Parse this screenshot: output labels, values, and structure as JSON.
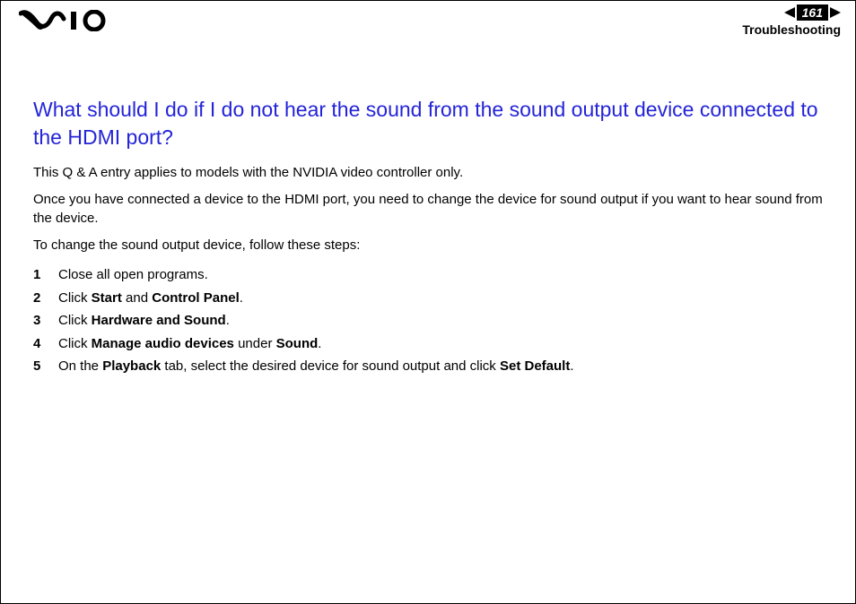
{
  "header": {
    "page_number": "161",
    "section": "Troubleshooting"
  },
  "title": "What should I do if I do not hear the sound from the sound output device connected to the HDMI port?",
  "para1": "This Q & A entry applies to models with the NVIDIA video controller only.",
  "para2": "Once you have connected a device to the HDMI port, you need to change the device for sound output if you want to hear sound from the device.",
  "para3": "To change the sound output device, follow these steps:",
  "steps": [
    {
      "n": "1",
      "segments": [
        {
          "t": "Close all open programs.",
          "b": false
        }
      ]
    },
    {
      "n": "2",
      "segments": [
        {
          "t": "Click ",
          "b": false
        },
        {
          "t": "Start",
          "b": true
        },
        {
          "t": " and ",
          "b": false
        },
        {
          "t": "Control Panel",
          "b": true
        },
        {
          "t": ".",
          "b": false
        }
      ]
    },
    {
      "n": "3",
      "segments": [
        {
          "t": "Click ",
          "b": false
        },
        {
          "t": "Hardware and Sound",
          "b": true
        },
        {
          "t": ".",
          "b": false
        }
      ]
    },
    {
      "n": "4",
      "segments": [
        {
          "t": "Click ",
          "b": false
        },
        {
          "t": "Manage audio devices",
          "b": true
        },
        {
          "t": " under ",
          "b": false
        },
        {
          "t": "Sound",
          "b": true
        },
        {
          "t": ".",
          "b": false
        }
      ]
    },
    {
      "n": "5",
      "segments": [
        {
          "t": "On the ",
          "b": false
        },
        {
          "t": "Playback",
          "b": true
        },
        {
          "t": " tab, select the desired device for sound output and click ",
          "b": false
        },
        {
          "t": "Set Default",
          "b": true
        },
        {
          "t": ".",
          "b": false
        }
      ]
    }
  ]
}
